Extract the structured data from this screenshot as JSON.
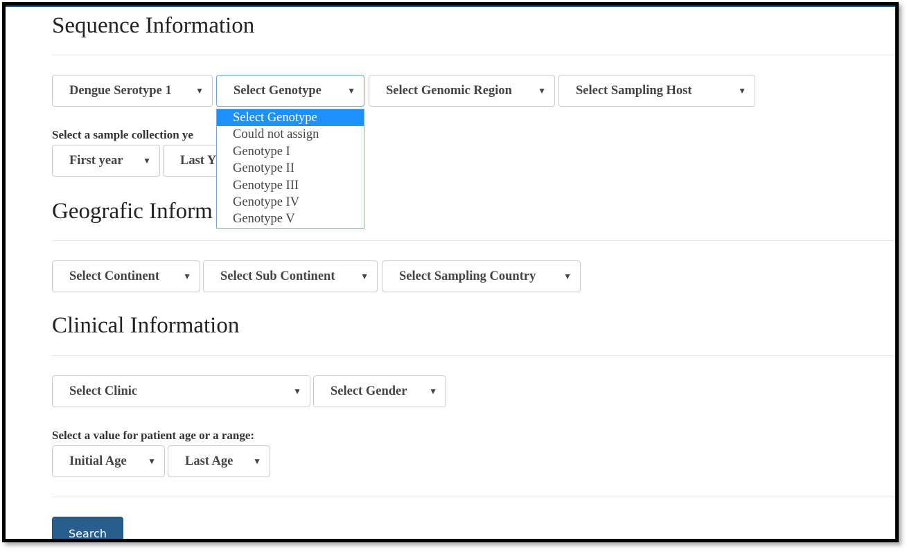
{
  "sections": {
    "sequence": {
      "title": "Sequence Information",
      "serotype": "Dengue Serotype 1",
      "genotype": "Select Genotype",
      "genomic_region": "Select Genomic Region",
      "sampling_host": "Select Sampling Host",
      "year_label": "Select a sample collection ye",
      "first_year": "First year",
      "last_year": "Last Y"
    },
    "geographic": {
      "title": "Geografic Inform",
      "continent": "Select Continent",
      "sub_continent": "Select Sub Continent",
      "country": "Select Sampling Country"
    },
    "clinical": {
      "title": "Clinical Information",
      "clinic": "Select Clinic",
      "gender": "Select Gender",
      "age_label": "Select a value for patient age or a range:",
      "initial_age": "Initial Age",
      "last_age": "Last Age"
    }
  },
  "genotype_dropdown": {
    "options": [
      "Select Genotype",
      "Could not assign",
      "Genotype I",
      "Genotype II",
      "Genotype III",
      "Genotype IV",
      "Genotype V"
    ],
    "selected_index": 0
  },
  "caret": "▼",
  "search_button": "Search",
  "colors": {
    "primary_button": "#285e8e",
    "highlight": "#1e90ff"
  }
}
